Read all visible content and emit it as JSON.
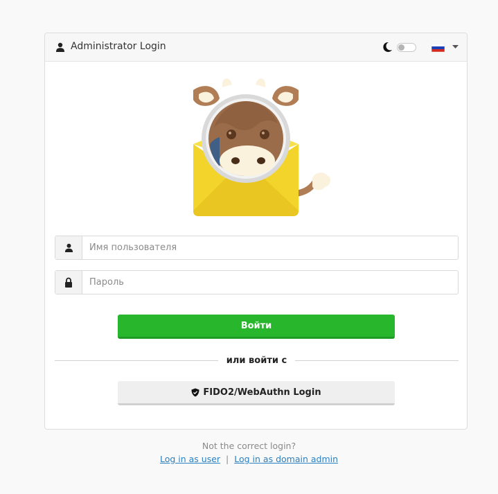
{
  "header": {
    "title": "Administrator Login",
    "theme_icon": "moon-icon",
    "theme_toggle_on": false,
    "language_flag": "flag-ru-icon"
  },
  "form": {
    "username_placeholder": "Имя пользователя",
    "password_placeholder": "Пароль",
    "username_value": "",
    "password_value": "",
    "login_label": "Войти",
    "divider_label": "или войти с",
    "fido_label": "FIDO2/WebAuthn Login"
  },
  "footer": {
    "question": "Not the correct login?",
    "user_link": "Log in as user",
    "separator": "|",
    "domain_admin_link": "Log in as domain admin"
  },
  "colors": {
    "primary_button": "#28b62c",
    "link": "#2a7fc0",
    "background": "#f9f9f9"
  }
}
